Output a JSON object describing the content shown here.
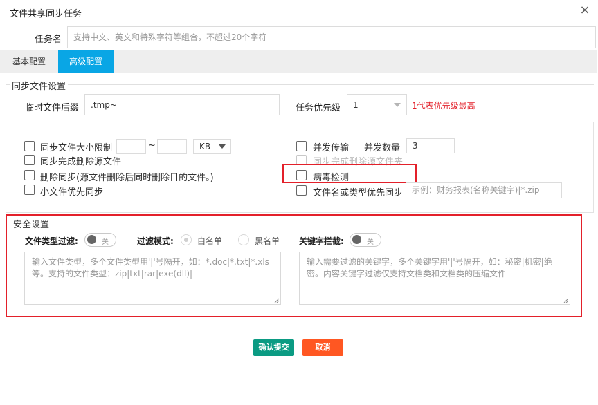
{
  "dialog": {
    "title": "文件共享同步任务",
    "close_icon": "×"
  },
  "task_name": {
    "label": "任务名",
    "placeholder": "支持中文、英文和特殊字符等组合，不超过20个字符"
  },
  "tabs": [
    {
      "label": "基本配置",
      "active": false
    },
    {
      "label": "高级配置",
      "active": true
    }
  ],
  "sync_settings": {
    "legend": "同步文件设置",
    "temp_suffix": {
      "label": "临时文件后缀",
      "value": ".tmp~"
    },
    "priority": {
      "label": "任务优先级",
      "value": "1",
      "hint": "1代表优先级最高"
    }
  },
  "options": {
    "size_limit": {
      "label": "同步文件大小限制",
      "separator": "~",
      "unit": "KB"
    },
    "delete_source": {
      "label": "同步完成删除源文件"
    },
    "delete_sync": {
      "label": "删除同步(源文件删除后同时删除目的文件。)"
    },
    "small_first": {
      "label": "小文件优先同步"
    },
    "concurrent": {
      "label": "并发传输",
      "count_label": "并发数量",
      "count_value": "3"
    },
    "delete_source_folder": {
      "label": "同步完成删除源文件夹"
    },
    "virus_scan": {
      "label": "病毒检测"
    },
    "name_priority": {
      "label": "文件名或类型优先同步",
      "placeholder": "示例：财务报表(名称关键字)|*.zip"
    }
  },
  "security": {
    "legend": "安全设置",
    "file_type_filter": {
      "label": "文件类型过滤:",
      "toggle_text": "关"
    },
    "filter_mode": {
      "label": "过滤模式:",
      "whitelist": "白名单",
      "blacklist": "黑名单"
    },
    "keyword_block": {
      "label": "关键字拦截:",
      "toggle_text": "关"
    },
    "file_types_placeholder": "输入文件类型，多个文件类型用'|'号隔开，如：*.doc|*.txt|*.xls等。支持的文件类型：zip|txt|rar|exe(dll)|",
    "keywords_placeholder": "输入需要过滤的关键字，多个关键字用'|'号隔开，如：秘密|机密|绝密。内容关键字过滤仅支持文档类和文档类的压缩文件"
  },
  "buttons": {
    "confirm": "确认提交",
    "cancel": "取消"
  },
  "colors": {
    "accent": "#09a6e5",
    "confirm": "#0b9b83",
    "cancel": "#ff5722",
    "highlight": "#e3202a",
    "hint": "#e3202a"
  }
}
